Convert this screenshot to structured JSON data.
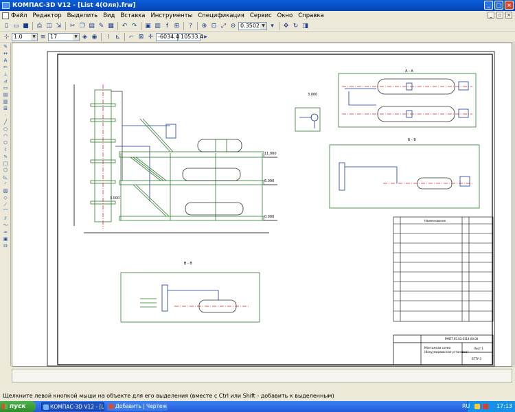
{
  "window": {
    "title": "КОМПАС-3D V12 - [List 4(Оля).frw]",
    "controls": [
      "_",
      "□",
      "×"
    ]
  },
  "menu": {
    "items": [
      "Файл",
      "Редактор",
      "Выделить",
      "Вид",
      "Вставка",
      "Инструменты",
      "Спецификация",
      "Сервис",
      "Окно",
      "Справка"
    ]
  },
  "toolbar": {
    "zoom_value": "0.3502",
    "line_scale": "1.0",
    "layer_value": "17",
    "coord_x": "-6034.4",
    "coord_y": "10533.4"
  },
  "drawing": {
    "section_aa_label": "А - А",
    "section_bb_label": "Б - Б",
    "section_vv_label": "В - В",
    "level_upper": "11.000",
    "level_mid": "6.000",
    "level_low": "0.000",
    "level_left_mark": "3.000",
    "level_aa_mark": "3.000",
    "title_block_code": "РМОТ 05.03.0314.00.00",
    "title_block_name1": "Монтажная схема",
    "title_block_name2": "(Вакуумированная установка)",
    "title_block_sheet": "Лист 1",
    "title_block_org": "БГТУ 3",
    "table_header": "Наименование"
  },
  "status": {
    "message": "Щелкните левой кнопкой мыши на объекте для его выделения (вместе с Ctrl или Shift - добавить к выделенным)"
  },
  "taskbar": {
    "start_label": "пуск",
    "tasks": [
      "КОМПАС-3D V12 - [Li...",
      "Добавить | Чертеж..."
    ],
    "lang": "RU",
    "clock": "17:13"
  }
}
